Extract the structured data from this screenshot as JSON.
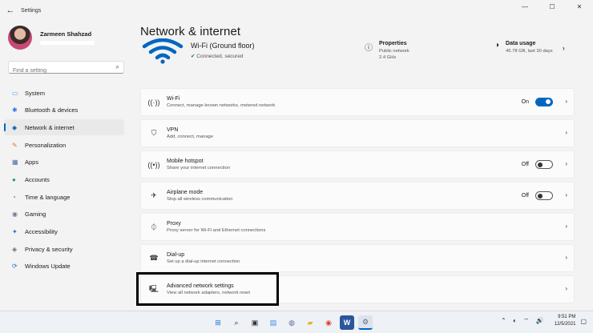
{
  "window": {
    "app_title": "Settings",
    "back": "←",
    "minimize": "—",
    "maximize": "☐",
    "close": "✕"
  },
  "profile": {
    "name": "Zarmeen Shahzad"
  },
  "search": {
    "placeholder": "Find a setting",
    "icon": "⌕"
  },
  "nav": [
    {
      "label": "System",
      "icon": "▭",
      "color": "#3a8ee6"
    },
    {
      "label": "Bluetooth & devices",
      "icon": "✱",
      "color": "#2b7bd6"
    },
    {
      "label": "Network & internet",
      "icon": "◆",
      "color": "#1f6fc5",
      "active": true
    },
    {
      "label": "Personalization",
      "icon": "✎",
      "color": "#d8772c"
    },
    {
      "label": "Apps",
      "icon": "▦",
      "color": "#4a6fa3"
    },
    {
      "label": "Accounts",
      "icon": "●",
      "color": "#22a06b"
    },
    {
      "label": "Time & language",
      "icon": "◔",
      "color": "#2d7dd2"
    },
    {
      "label": "Gaming",
      "icon": "◉",
      "color": "#6b7a8f"
    },
    {
      "label": "Accessibility",
      "icon": "✦",
      "color": "#2670c9"
    },
    {
      "label": "Privacy & security",
      "icon": "◈",
      "color": "#5b6b80"
    },
    {
      "label": "Windows Update",
      "icon": "⟳",
      "color": "#1e74d1"
    }
  ],
  "page": {
    "title": "Network & internet",
    "connection_name": "Wi-Fi (Ground floor)",
    "connection_status": "Connected, secured",
    "properties": {
      "title": "Properties",
      "line1": "Public network",
      "line2": "2.4 GHz",
      "icon": "ⓘ"
    },
    "data_usage": {
      "title": "Data usage",
      "line1": "45.78 GB, last 30 days",
      "icon": "◑",
      "chevron": "›"
    }
  },
  "cards": [
    {
      "title": "Wi-Fi",
      "sub": "Connect, manage known networks, metered network",
      "icon": "((·))",
      "toggle": "On"
    },
    {
      "title": "VPN",
      "sub": "Add, connect, manage",
      "icon": "⛉"
    },
    {
      "title": "Mobile hotspot",
      "sub": "Share your internet connection",
      "icon": "((•))",
      "toggle": "Off"
    },
    {
      "title": "Airplane mode",
      "sub": "Stop all wireless communication",
      "icon": "✈",
      "toggle": "Off"
    },
    {
      "title": "Proxy",
      "sub": "Proxy server for Wi-Fi and Ethernet connections",
      "icon": "⏀"
    },
    {
      "title": "Dial-up",
      "sub": "Set up a dial-up internet connection",
      "icon": "☎"
    },
    {
      "title": "Advanced network settings",
      "sub": "View all network adapters, network reset",
      "icon": "🖳"
    }
  ],
  "chevron": "›",
  "taskbar": {
    "apps": [
      {
        "name": "start",
        "glyph": "⊞",
        "color": "#1e74d1"
      },
      {
        "name": "search",
        "glyph": "⌕",
        "color": "#222"
      },
      {
        "name": "task-view",
        "glyph": "▣",
        "color": "#333"
      },
      {
        "name": "widgets",
        "glyph": "▤",
        "color": "#3a8ee6"
      },
      {
        "name": "teams-chat",
        "glyph": "◍",
        "color": "#6264a7"
      },
      {
        "name": "file-explorer",
        "glyph": "▰",
        "color": "#e6b422"
      },
      {
        "name": "chrome",
        "glyph": "◉",
        "color": "#db4437"
      },
      {
        "name": "word",
        "glyph": "W",
        "color": "#2b579a"
      },
      {
        "name": "settings",
        "glyph": "⚙",
        "color": "#5b6b80",
        "active": true
      }
    ],
    "tray": "⌃ ◐ ⌔ 🔊",
    "time": "9:51 PM",
    "date": "12/5/2021",
    "notifications": "▢"
  }
}
